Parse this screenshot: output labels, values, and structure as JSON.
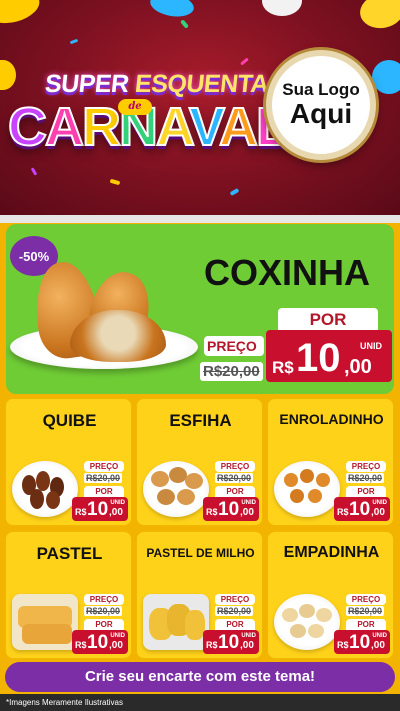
{
  "header": {
    "title_line1_a": "SUPER ",
    "title_line1_b": "ESQUENTA",
    "title_de": "de",
    "title_line2": [
      "C",
      "A",
      "R",
      "N",
      "A",
      "V",
      "A",
      "L"
    ],
    "logo_line1": "Sua Logo",
    "logo_line2": "Aqui"
  },
  "featured": {
    "discount": "-50%",
    "name": "COXINHA",
    "preco_label": "PREÇO",
    "old_price": "R$20,00",
    "por_label": "POR",
    "unid_label": "UNID",
    "currency": "R$",
    "price_int": "10",
    "price_dec": ",00"
  },
  "products": [
    {
      "name": "QUIBE",
      "preco_label": "PREÇO",
      "old_price": "R$20,00",
      "por_label": "POR",
      "unid_label": "UNID",
      "currency": "R$",
      "price_int": "10",
      "price_dec": ",00"
    },
    {
      "name": "ESFIHA",
      "preco_label": "PREÇO",
      "old_price": "R$20,00",
      "por_label": "POR",
      "unid_label": "UNID",
      "currency": "R$",
      "price_int": "10",
      "price_dec": ",00"
    },
    {
      "name": "ENROLADINHO",
      "preco_label": "PREÇO",
      "old_price": "R$20,00",
      "por_label": "POR",
      "unid_label": "UNID",
      "currency": "R$",
      "price_int": "10",
      "price_dec": ",00"
    },
    {
      "name": "PASTEL",
      "preco_label": "PREÇO",
      "old_price": "R$20,00",
      "por_label": "POR",
      "unid_label": "UNID",
      "currency": "R$",
      "price_int": "10",
      "price_dec": ",00"
    },
    {
      "name": "PASTEL DE MILHO",
      "preco_label": "PREÇO",
      "old_price": "R$20,00",
      "por_label": "POR",
      "unid_label": "UNID",
      "currency": "R$",
      "price_int": "10",
      "price_dec": ",00"
    },
    {
      "name": "EMPADINHA",
      "preco_label": "PREÇO",
      "old_price": "R$20,00",
      "por_label": "POR",
      "unid_label": "UNID",
      "currency": "R$",
      "price_int": "10",
      "price_dec": ",00"
    }
  ],
  "cta": "Crie seu encarte com este tema!",
  "footnote": "*Imagens Meramente Ilustrativas",
  "colors": {
    "header_red": "#7a1020",
    "featured_green": "#6fcc35",
    "card_yellow": "#ffd21a",
    "price_red": "#c8102e",
    "purple": "#7b2ea6"
  }
}
